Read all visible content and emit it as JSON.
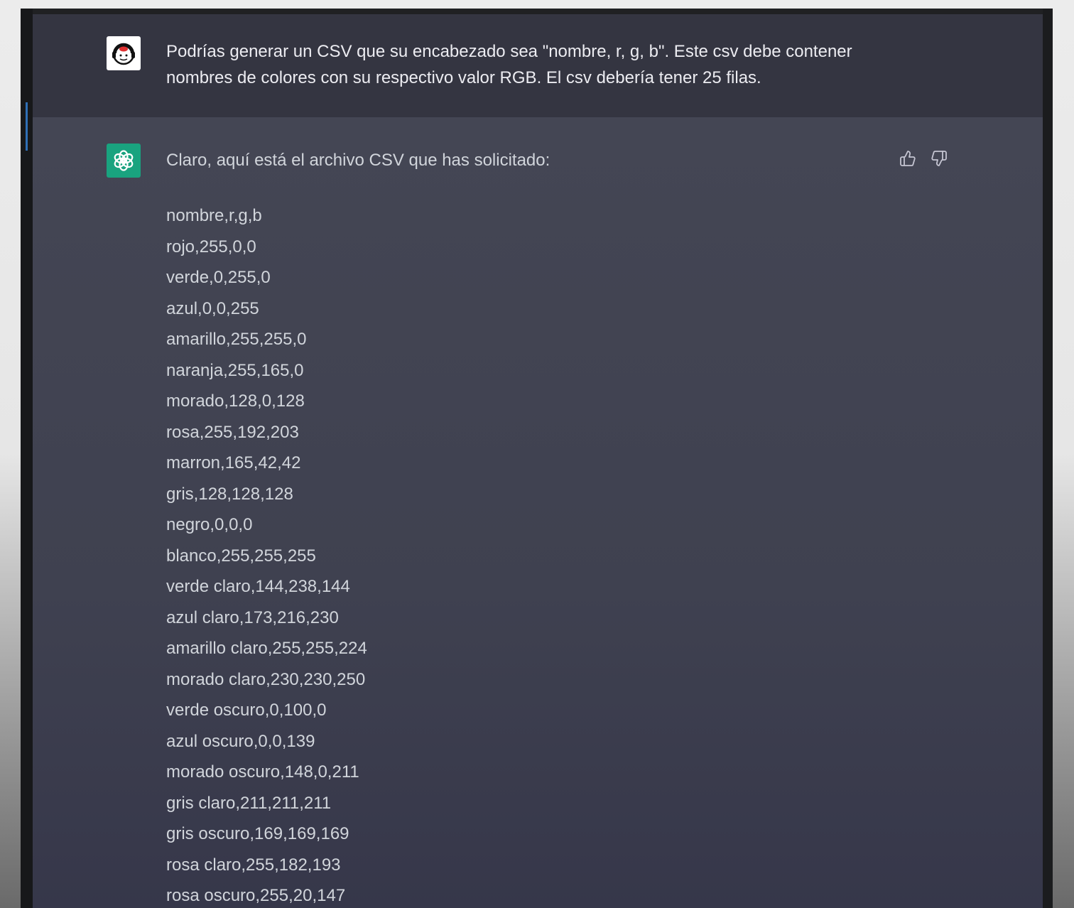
{
  "user_message": {
    "line1": "Podrías generar un CSV que su encabezado sea \"nombre, r, g, b\". Este csv debe contener",
    "line2": "nombres de colores con su respectivo valor RGB. El csv debería tener 25 filas."
  },
  "assistant_message": {
    "intro": "Claro, aquí está el archivo CSV que has solicitado:",
    "lines": [
      "nombre,r,g,b",
      "rojo,255,0,0",
      "verde,0,255,0",
      "azul,0,0,255",
      "amarillo,255,255,0",
      "naranja,255,165,0",
      "morado,128,0,128",
      "rosa,255,192,203",
      "marron,165,42,42",
      "gris,128,128,128",
      "negro,0,0,0",
      "blanco,255,255,255",
      "verde claro,144,238,144",
      "azul claro,173,216,230",
      "amarillo claro,255,255,224",
      "morado claro,230,230,250",
      "verde oscuro,0,100,0",
      "azul oscuro,0,0,139",
      "morado oscuro,148,0,211",
      "gris claro,211,211,211",
      "gris oscuro,169,169,169",
      "rosa claro,255,182,193",
      "rosa oscuro,255,20,147"
    ]
  },
  "icons": {
    "user_avatar": "user-avatar-icon",
    "assistant_avatar": "openai-logo-icon",
    "like": "thumbs-up-icon",
    "dislike": "thumbs-down-icon"
  },
  "colors": {
    "user_bg": "#343541",
    "assistant_bg": "#444654",
    "assistant_avatar_bg": "#19a37f",
    "text": "#d1d5db"
  }
}
